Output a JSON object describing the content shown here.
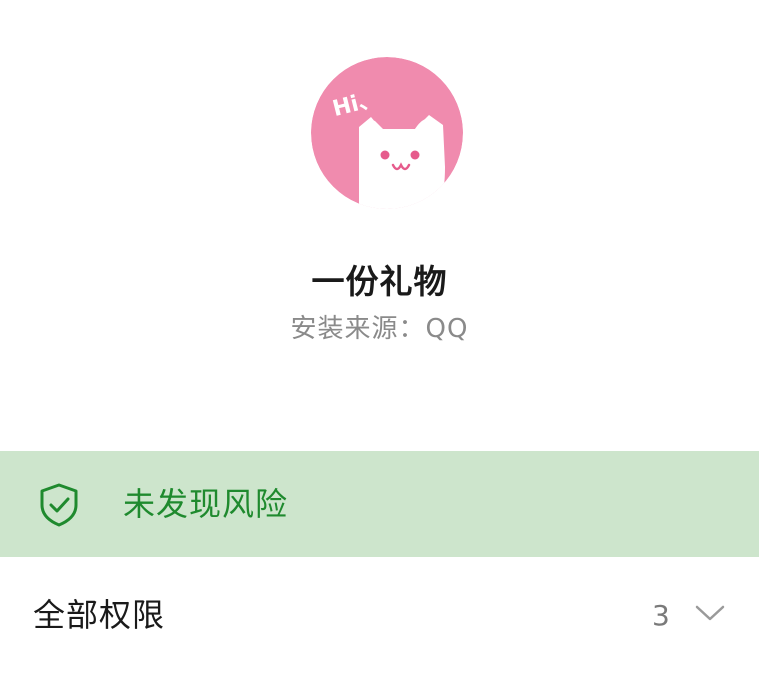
{
  "app": {
    "name": "一份礼物",
    "install_source": "安装来源：QQ",
    "icon": "cat-hi-icon",
    "icon_text": "Hi、"
  },
  "risk": {
    "status_text": "未发现风险",
    "icon": "shield-check-icon",
    "status_color": "#1f8a2e",
    "banner_color": "#cde5cc"
  },
  "permissions": {
    "label": "全部权限",
    "count": "3",
    "icon": "chevron-down-icon"
  },
  "colors": {
    "icon_background": "#f08bae",
    "icon_cat": "#ffffff",
    "icon_face": "#e65b8c"
  }
}
